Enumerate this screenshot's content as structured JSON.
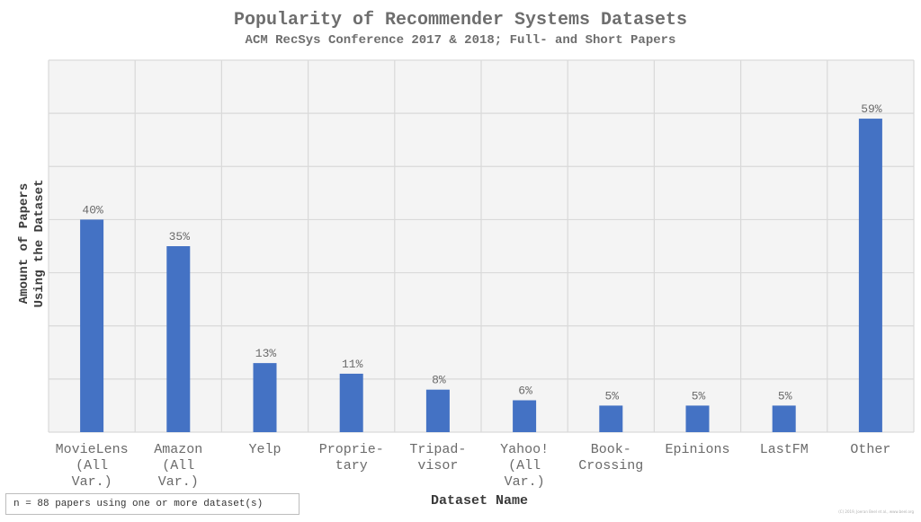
{
  "chart_data": {
    "type": "bar",
    "title": "Popularity of Recommender Systems Datasets",
    "subtitle": "ACM RecSys Conference 2017 & 2018; Full- and Short Papers",
    "xlabel": "Dataset Name",
    "ylabel": [
      "Amount of Papers",
      "Using the Dataset"
    ],
    "categories": [
      [
        "MovieLens",
        "(All",
        "Var.)"
      ],
      [
        "Amazon",
        "(All",
        "Var.)"
      ],
      [
        "Yelp"
      ],
      [
        "Proprie-",
        "tary"
      ],
      [
        "Tripad-",
        "visor"
      ],
      [
        "Yahoo!",
        "(All",
        "Var.)"
      ],
      [
        "Book-",
        "Crossing"
      ],
      [
        "Epinions"
      ],
      [
        "LastFM"
      ],
      [
        "Other"
      ]
    ],
    "values": [
      40,
      35,
      13,
      11,
      8,
      6,
      5,
      5,
      5,
      59
    ],
    "data_labels": [
      "40%",
      "35%",
      "13%",
      "11%",
      "8%",
      "6%",
      "5%",
      "5%",
      "5%",
      "59%"
    ],
    "ylim": [
      0,
      70
    ],
    "ytick_step": 10,
    "y_tick_labels_shown": false,
    "grid": true,
    "bar_color": "#4472c4",
    "plot_background": "#f4f4f4",
    "grid_color": "#d9d9d9"
  },
  "note": "n = 88 papers using one or more dataset(s)",
  "credit": "(C) 2019, Joeran Beel et al., www.beel.org"
}
